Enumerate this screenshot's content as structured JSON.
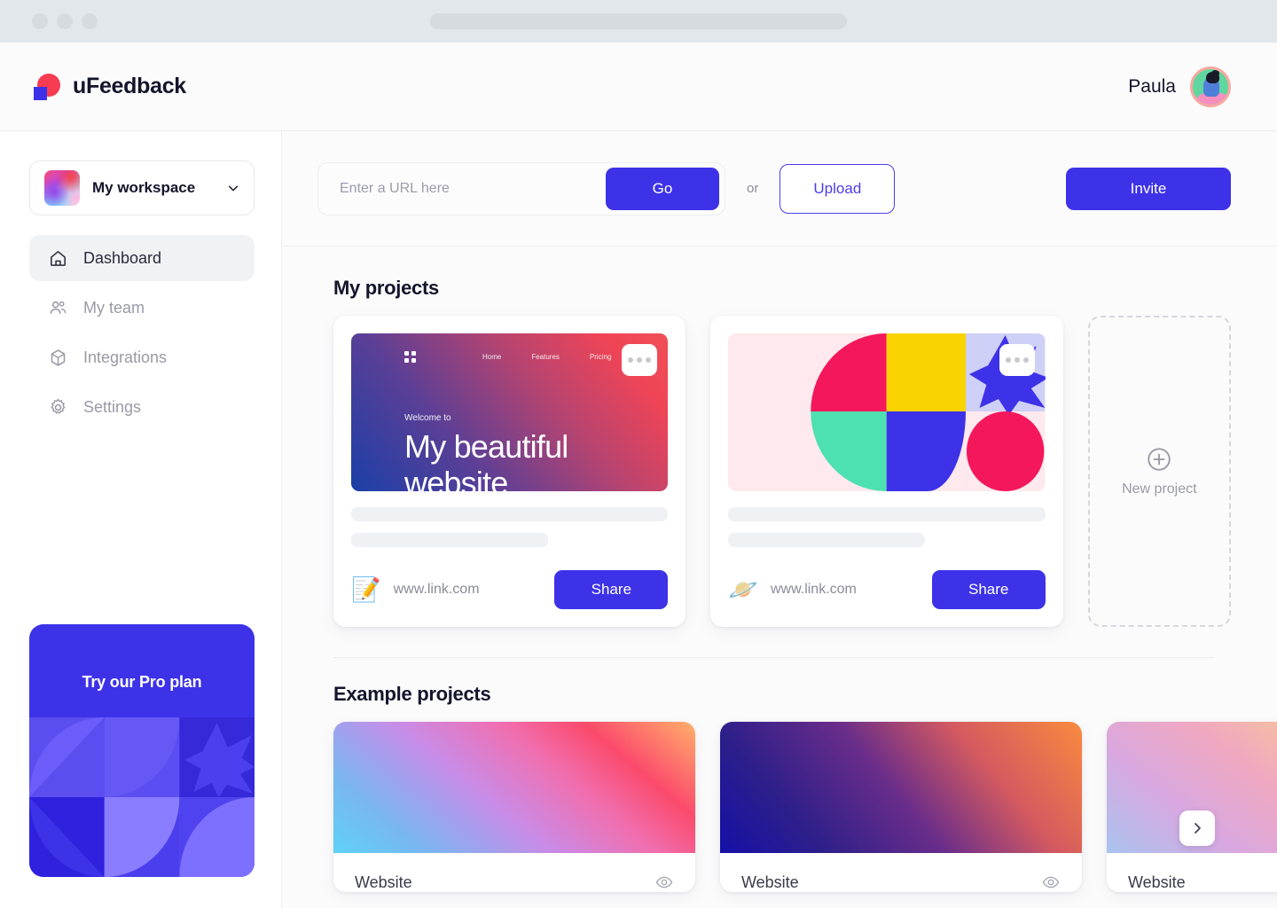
{
  "browser": {
    "dots": 3
  },
  "header": {
    "brand_name": "uFeedback",
    "logo_icon": "ufeedback-logo",
    "user_name": "Paula",
    "avatar_icon": "user-avatar"
  },
  "sidebar": {
    "workspace": {
      "name": "My workspace",
      "chevron_icon": "chevron-down-icon",
      "thumb_icon": "workspace-thumbnail"
    },
    "items": [
      {
        "label": "Dashboard",
        "icon": "home-icon",
        "active": true
      },
      {
        "label": "My team",
        "icon": "users-icon",
        "active": false
      },
      {
        "label": "Integrations",
        "icon": "cube-icon",
        "active": false
      },
      {
        "label": "Settings",
        "icon": "gear-icon",
        "active": false
      }
    ],
    "promo": {
      "title": "Try our Pro plan"
    }
  },
  "toolbar": {
    "url_placeholder": "Enter a URL here",
    "url_value": "",
    "go_label": "Go",
    "or_label": "or",
    "upload_label": "Upload",
    "invite_label": "Invite"
  },
  "my_projects": {
    "section_title": "My projects",
    "cards": [
      {
        "emoji": "📝",
        "emoji_name": "memo-emoji",
        "link": "www.link.com",
        "share_label": "Share",
        "menu_icon": "more-options-icon",
        "preview": {
          "logo_icon": "site-logo-icon",
          "nav": [
            "Home",
            "Features",
            "Pricing"
          ],
          "eyebrow": "Welcome to",
          "title": "My beautiful website"
        }
      },
      {
        "emoji": "🪐",
        "emoji_name": "ringed-planet-emoji",
        "link": "www.link.com",
        "share_label": "Share",
        "menu_icon": "more-options-icon",
        "preview": {
          "style": "bauhaus-abstract"
        }
      }
    ],
    "new_project": {
      "label": "New project",
      "icon": "plus-circle-icon"
    }
  },
  "example_projects": {
    "section_title": "Example projects",
    "next_icon": "chevron-right-icon",
    "cards": [
      {
        "name": "Website",
        "action_icon": "eye-icon"
      },
      {
        "name": "Website",
        "action_icon": "eye-icon"
      },
      {
        "name": "Website",
        "action_icon": "eye-icon"
      }
    ]
  },
  "colors": {
    "accent": "#3d32e8",
    "accent_border": "#4a3ee8",
    "logo_red": "#f63b52",
    "text_primary": "#14142b",
    "text_muted": "#9a9aa8",
    "chrome": "#e2e7eb",
    "page_bg": "#fbfbfc"
  }
}
